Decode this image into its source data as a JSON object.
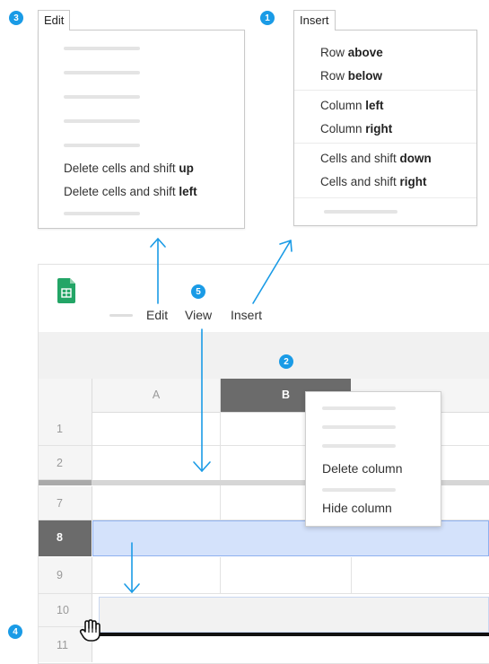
{
  "badges": {
    "insert": "1",
    "column_b": "2",
    "edit": "3",
    "drag_row": "4",
    "view": "5"
  },
  "edit_menu": {
    "tab_label": "Edit",
    "items": [
      {
        "prefix": "Delete cells and shift ",
        "bold": "up"
      },
      {
        "prefix": "Delete cells and shift ",
        "bold": "left"
      }
    ]
  },
  "insert_menu": {
    "tab_label": "Insert",
    "items": [
      {
        "prefix": "Row ",
        "bold": "above"
      },
      {
        "prefix": "Row ",
        "bold": "below"
      },
      {
        "prefix": "Column ",
        "bold": "left"
      },
      {
        "prefix": "Column ",
        "bold": "right"
      },
      {
        "prefix": "Cells and shift ",
        "bold": "down"
      },
      {
        "prefix": "Cells and shift ",
        "bold": "right"
      }
    ]
  },
  "menubar": {
    "edit": "Edit",
    "view": "View",
    "insert": "Insert"
  },
  "columns": [
    "A",
    "B"
  ],
  "rows": [
    "1",
    "2",
    "7",
    "8",
    "9",
    "10",
    "11"
  ],
  "context_menu": {
    "delete_column": "Delete column",
    "hide_column": "Hide column"
  },
  "colors": {
    "accent_blue": "#1a9be6",
    "selection_fill": "#d4e2fb",
    "selected_header": "#666666",
    "sheets_green": "#23a566"
  },
  "icons": [
    "sheets-logo-icon",
    "hand-cursor-icon",
    "arrow-icon"
  ]
}
